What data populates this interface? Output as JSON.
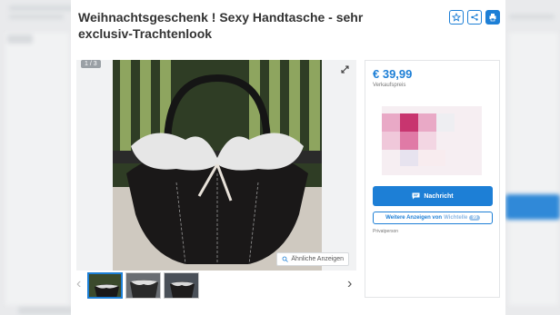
{
  "listing": {
    "title": "Weihnachtsgeschenk ! Sexy Handtasche - sehr exclusiv-Trachtenlook",
    "actions": [
      "star-icon",
      "share-icon",
      "print-icon"
    ]
  },
  "gallery": {
    "counter": "1 / 3",
    "similar_label": "Ähnliche Anzeigen",
    "thumbnail_count": 3
  },
  "sidebar": {
    "price": "€ 39,99",
    "price_label": "Verkaufspreis",
    "contact_label": "Nachricht",
    "more_ads_label": "Weitere Anzeigen von",
    "more_ads_name": "Wichtelle",
    "more_ads_badge": "99",
    "seller_type": "Privatperson"
  },
  "colors": {
    "accent": "#1d7fd6",
    "price": "#1d7fd6"
  }
}
